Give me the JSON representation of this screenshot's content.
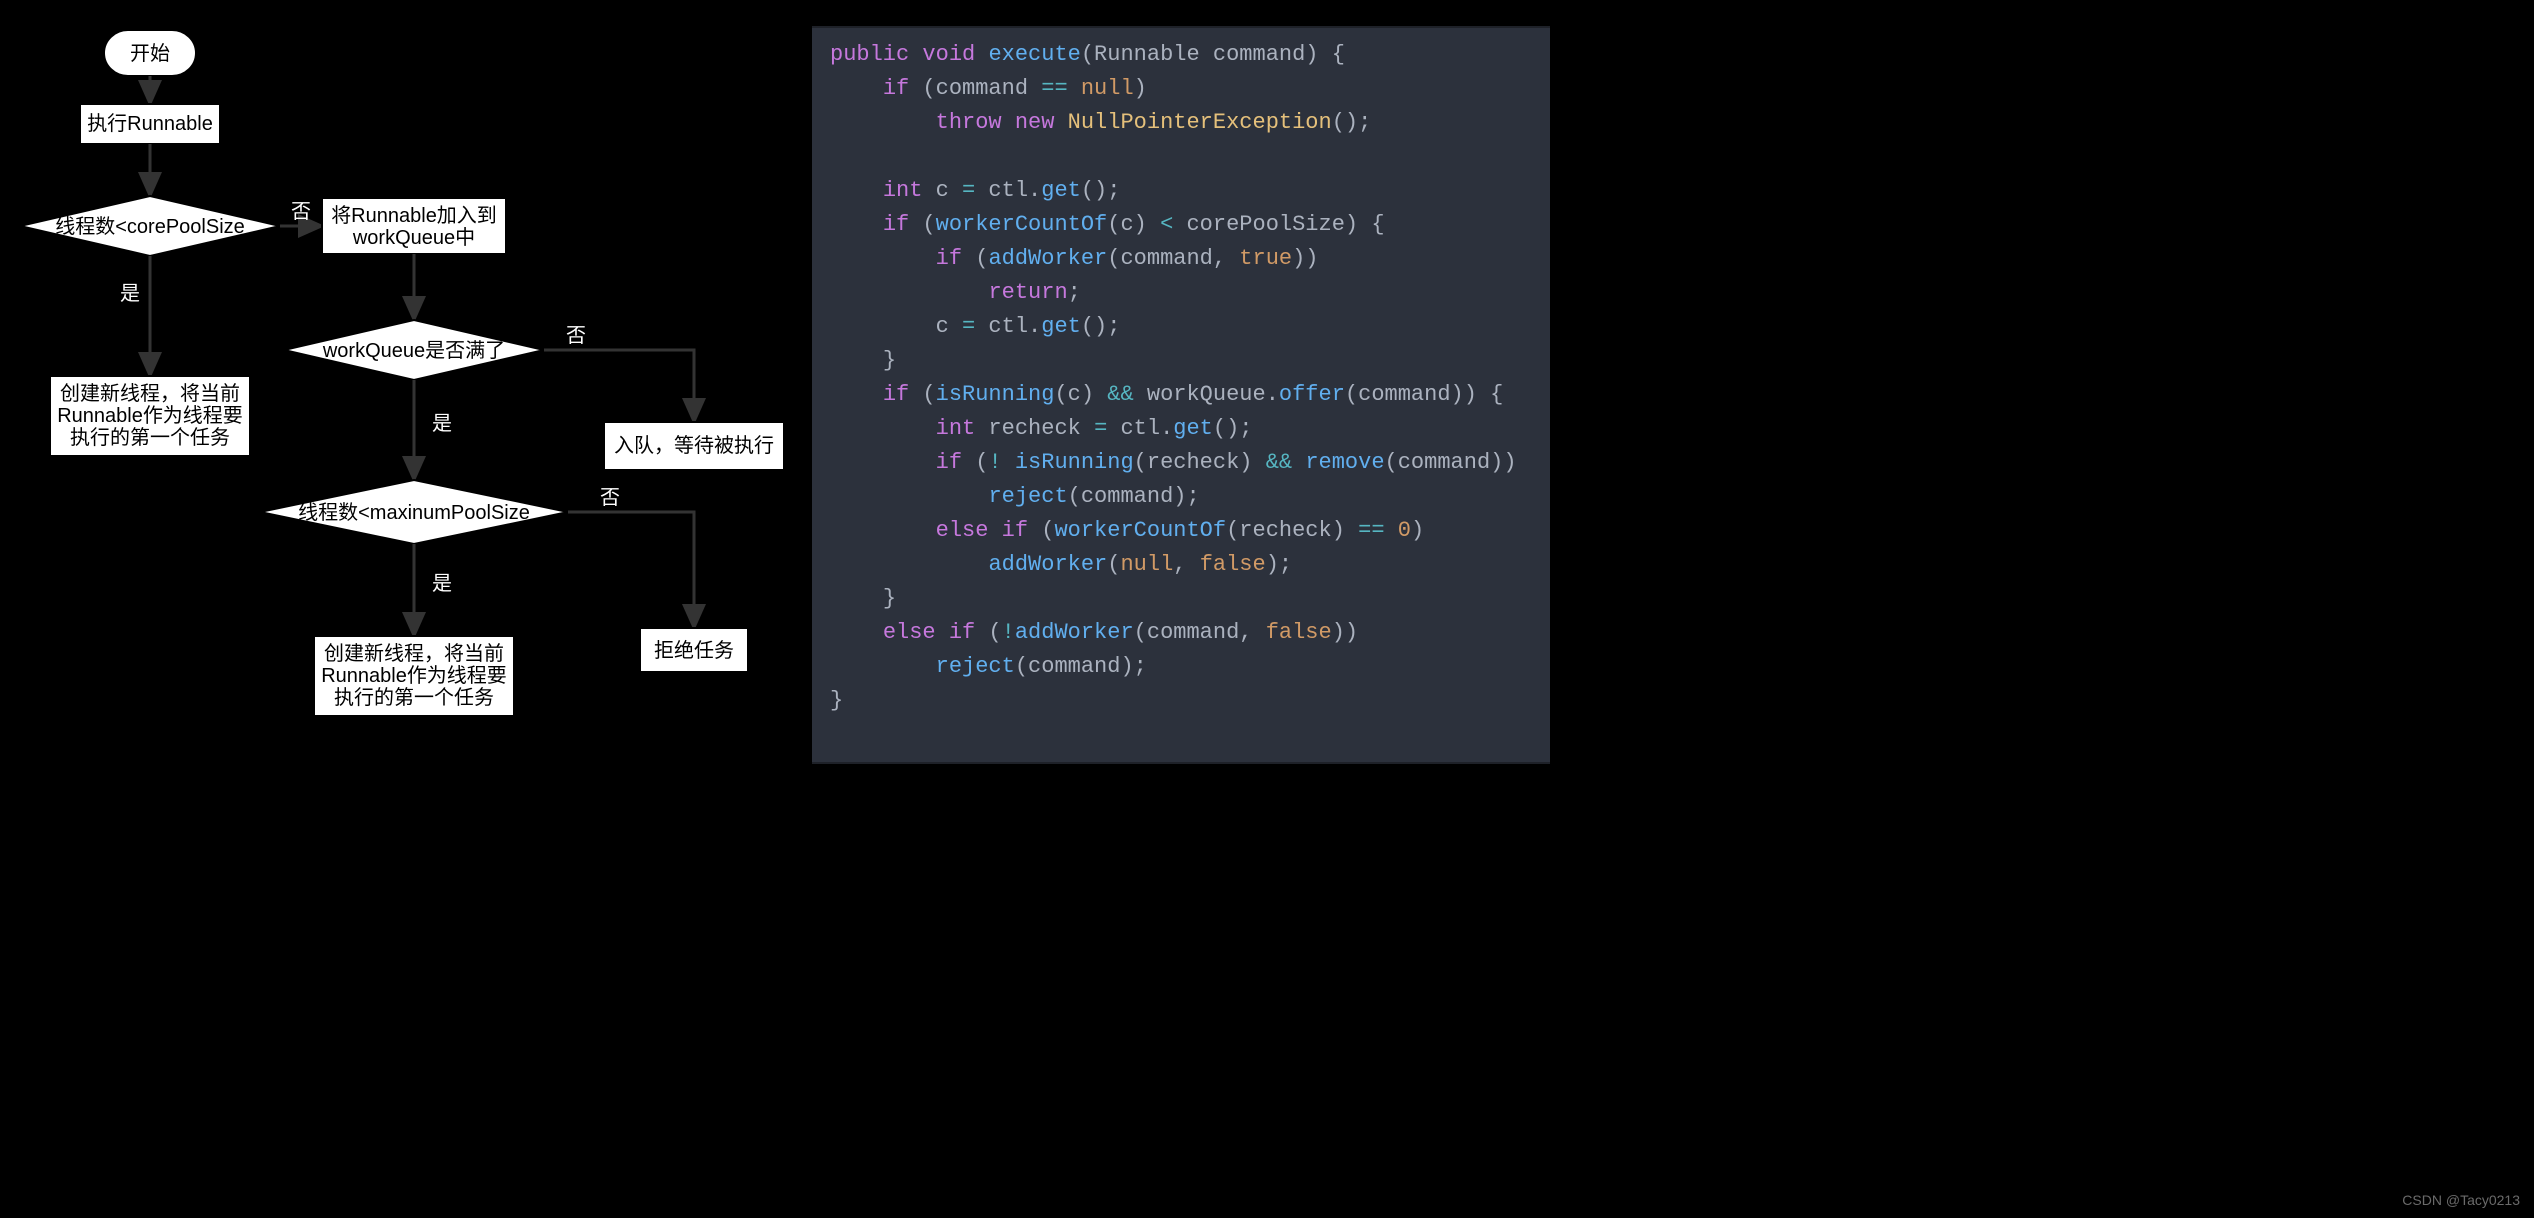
{
  "watermark": "CSDN @Tacy0213",
  "flow": {
    "start": "开始",
    "exec": "执行Runnable",
    "d1": "线程数<corePoolSize",
    "p1l1": "创建新线程，将当前",
    "p1l2": "Runnable作为线程要",
    "p1l3": "执行的第一个任务",
    "enq1": "将Runnable加入到",
    "enq2": "workQueue中",
    "d2": "workQueue是否满了",
    "wait": "入队，等待被执行",
    "d3": "线程数<maxinumPoolSize",
    "p2l1": "创建新线程，将当前",
    "p2l2": "Runnable作为线程要",
    "p2l3": "执行的第一个任务",
    "reject": "拒绝任务",
    "yes": "是",
    "no": "否"
  },
  "code": {
    "l1": {
      "a": "public",
      "b": "void",
      "c": "execute",
      "d": "(Runnable command) {"
    },
    "l2": {
      "a": "if",
      "b": " (command ",
      "c": "==",
      "d": " ",
      "e": "null",
      "f": ")"
    },
    "l3": {
      "a": "throw",
      "b": "new",
      "c": "NullPointerException",
      "d": "();"
    },
    "l5": {
      "a": "int",
      "b": " c ",
      "c": "=",
      "d": " ctl.",
      "e": "get",
      "f": "();"
    },
    "l6": {
      "a": "if",
      "b": " (",
      "c": "workerCountOf",
      "d": "(c) ",
      "e": "<",
      "f": " corePoolSize) {"
    },
    "l7": {
      "a": "if",
      "b": " (",
      "c": "addWorker",
      "d": "(command, ",
      "e": "true",
      "f": "))"
    },
    "l8": {
      "a": "return",
      "b": ";"
    },
    "l9": {
      "a": "c ",
      "b": "=",
      "c": " ctl.",
      "d": "get",
      "e": "();"
    },
    "l10": {
      "a": "}"
    },
    "l11": {
      "a": "if",
      "b": " (",
      "c": "isRunning",
      "d": "(c) ",
      "e": "&&",
      "f": " workQueue.",
      "g": "offer",
      "h": "(command)) {"
    },
    "l12": {
      "a": "int",
      "b": " recheck ",
      "c": "=",
      "d": " ctl.",
      "e": "get",
      "f": "();"
    },
    "l13": {
      "a": "if",
      "b": " (",
      "c": "!",
      "d": " ",
      "e": "isRunning",
      "f": "(recheck) ",
      "g": "&&",
      "h": " ",
      "i": "remove",
      "j": "(command))"
    },
    "l14": {
      "a": "reject",
      "b": "(command);"
    },
    "l15": {
      "a": "else if",
      "b": " (",
      "c": "workerCountOf",
      "d": "(recheck) ",
      "e": "==",
      "f": " ",
      "g": "0",
      "h": ")"
    },
    "l16": {
      "a": "addWorker",
      "b": "(",
      "c": "null",
      "d": ", ",
      "e": "false",
      "f": ");"
    },
    "l17": {
      "a": "}"
    },
    "l18": {
      "a": "else if",
      "b": " (",
      "c": "!",
      "d": "addWorker",
      "e": "(command, ",
      "f": "false",
      "g": "))"
    },
    "l19": {
      "a": "reject",
      "b": "(command);"
    },
    "l20": {
      "a": "}"
    }
  }
}
